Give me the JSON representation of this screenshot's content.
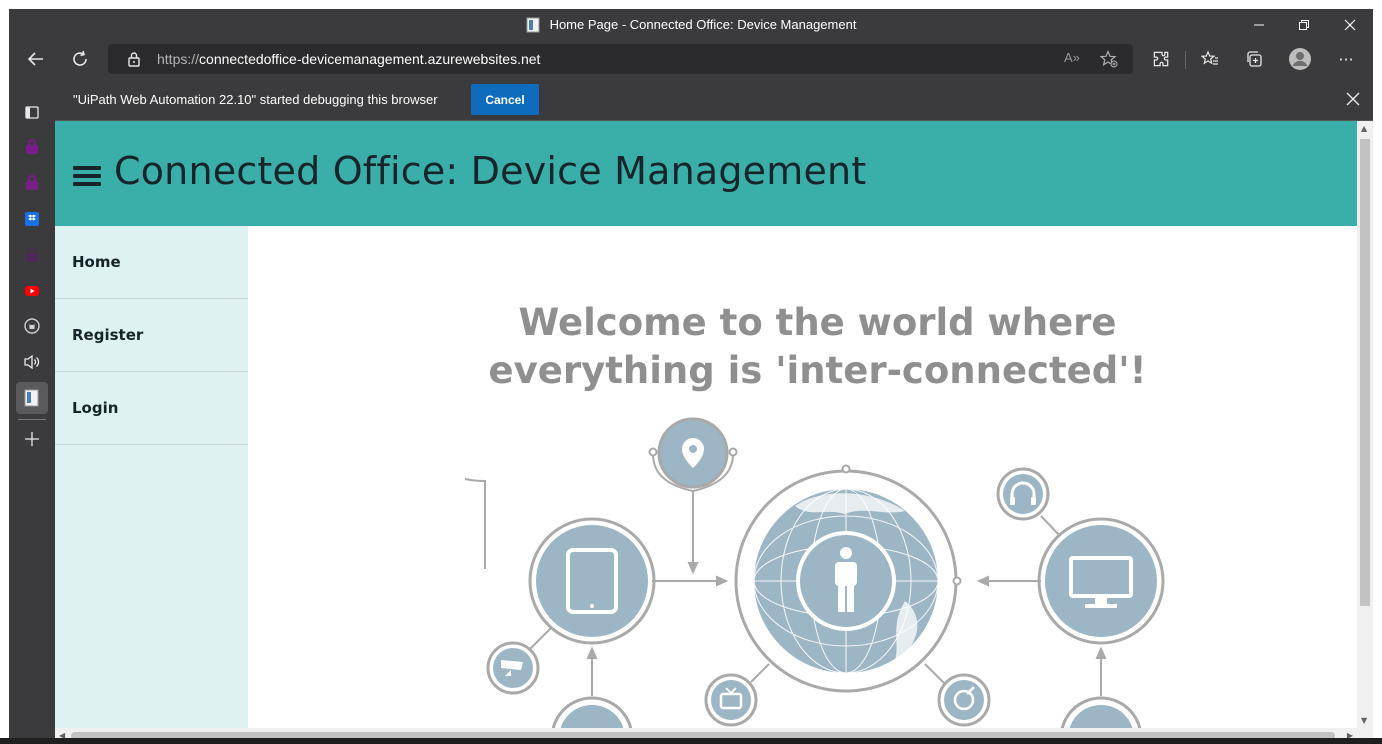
{
  "window": {
    "title": "Home Page - Connected Office: Device Management",
    "minimize": "—",
    "restore": "❐",
    "close": "✕"
  },
  "toolbar": {
    "url_scheme": "https://",
    "url_host": "connectedoffice-devicemanagement.azurewebsites.net",
    "read_aloud_label": "A»",
    "more_label": "···"
  },
  "infobar": {
    "message": "\"UiPath Web Automation 22.10\" started debugging this browser",
    "cancel_label": "Cancel",
    "close_label": "✕"
  },
  "site": {
    "title": "Connected Office: Device Management",
    "nav": [
      {
        "label": "Home"
      },
      {
        "label": "Register"
      },
      {
        "label": "Login"
      }
    ],
    "welcome_line1": "Welcome to the world where",
    "welcome_line2": "everything is 'inter-connected'!"
  },
  "colors": {
    "header": "#3aafa9",
    "nav_bg": "#def2f1",
    "text_dark": "#17252a",
    "welcome_text": "#8f8f8f",
    "graphic_fill": "#9db6c5",
    "graphic_stroke": "#a9a9a9",
    "cancel_button": "#0f6cbd"
  },
  "sidebar_icons": [
    "tabs-icon",
    "extension-icon-1",
    "extension-icon-2",
    "dropbox-icon",
    "extension-icon-3",
    "youtube-icon",
    "github-icon",
    "audio-icon",
    "active-tab-icon",
    "add-icon"
  ]
}
